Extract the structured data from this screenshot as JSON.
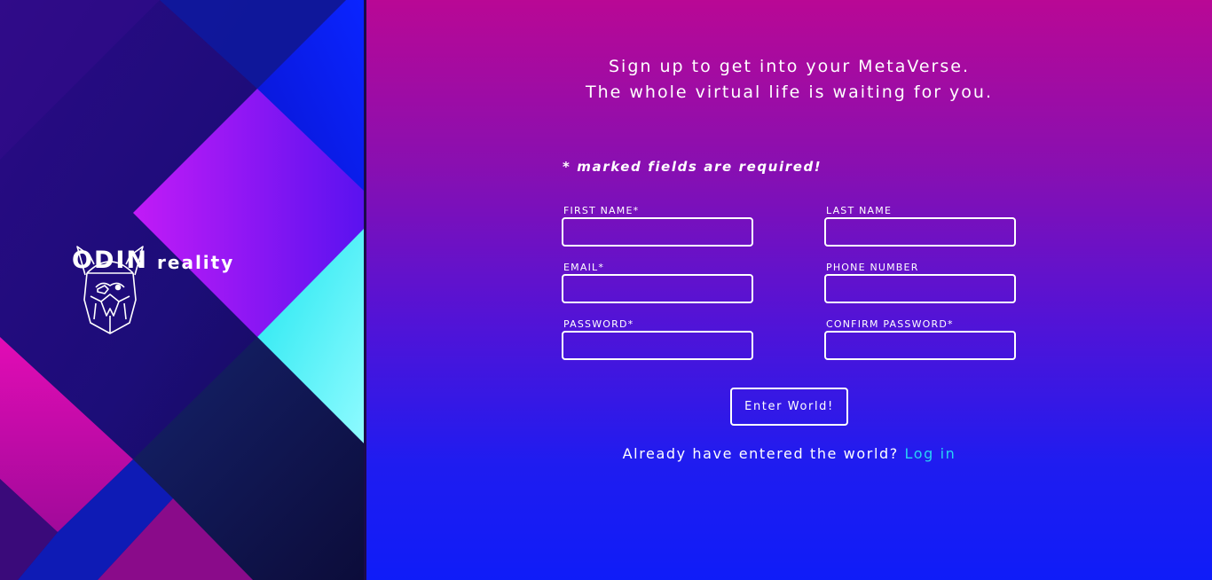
{
  "brand": {
    "name_primary": "ODIN",
    "name_secondary": "reality",
    "logo_icon": "viking-helmet-icon"
  },
  "headline": {
    "line1": "Sign up to get into your MetaVerse.",
    "line2": "The whole virtual life is waiting for you."
  },
  "form": {
    "required_note": "* marked fields are required!",
    "fields": {
      "first_name": {
        "label": "FIRST NAME*",
        "value": ""
      },
      "last_name": {
        "label": "LAST NAME",
        "value": ""
      },
      "email": {
        "label": "EMAIL*",
        "value": ""
      },
      "phone": {
        "label": "PHONE NUMBER",
        "value": ""
      },
      "password": {
        "label": "PASSWORD*",
        "value": ""
      },
      "confirm_password": {
        "label": "CONFIRM PASSWORD*",
        "value": ""
      }
    },
    "submit_label": "Enter World!"
  },
  "login": {
    "prompt": "Already have entered the world?",
    "link_label": "Log in"
  },
  "colors": {
    "accent_link": "#28d3f4",
    "panel_top": "#b90895",
    "panel_bottom": "#0f1cf8"
  }
}
